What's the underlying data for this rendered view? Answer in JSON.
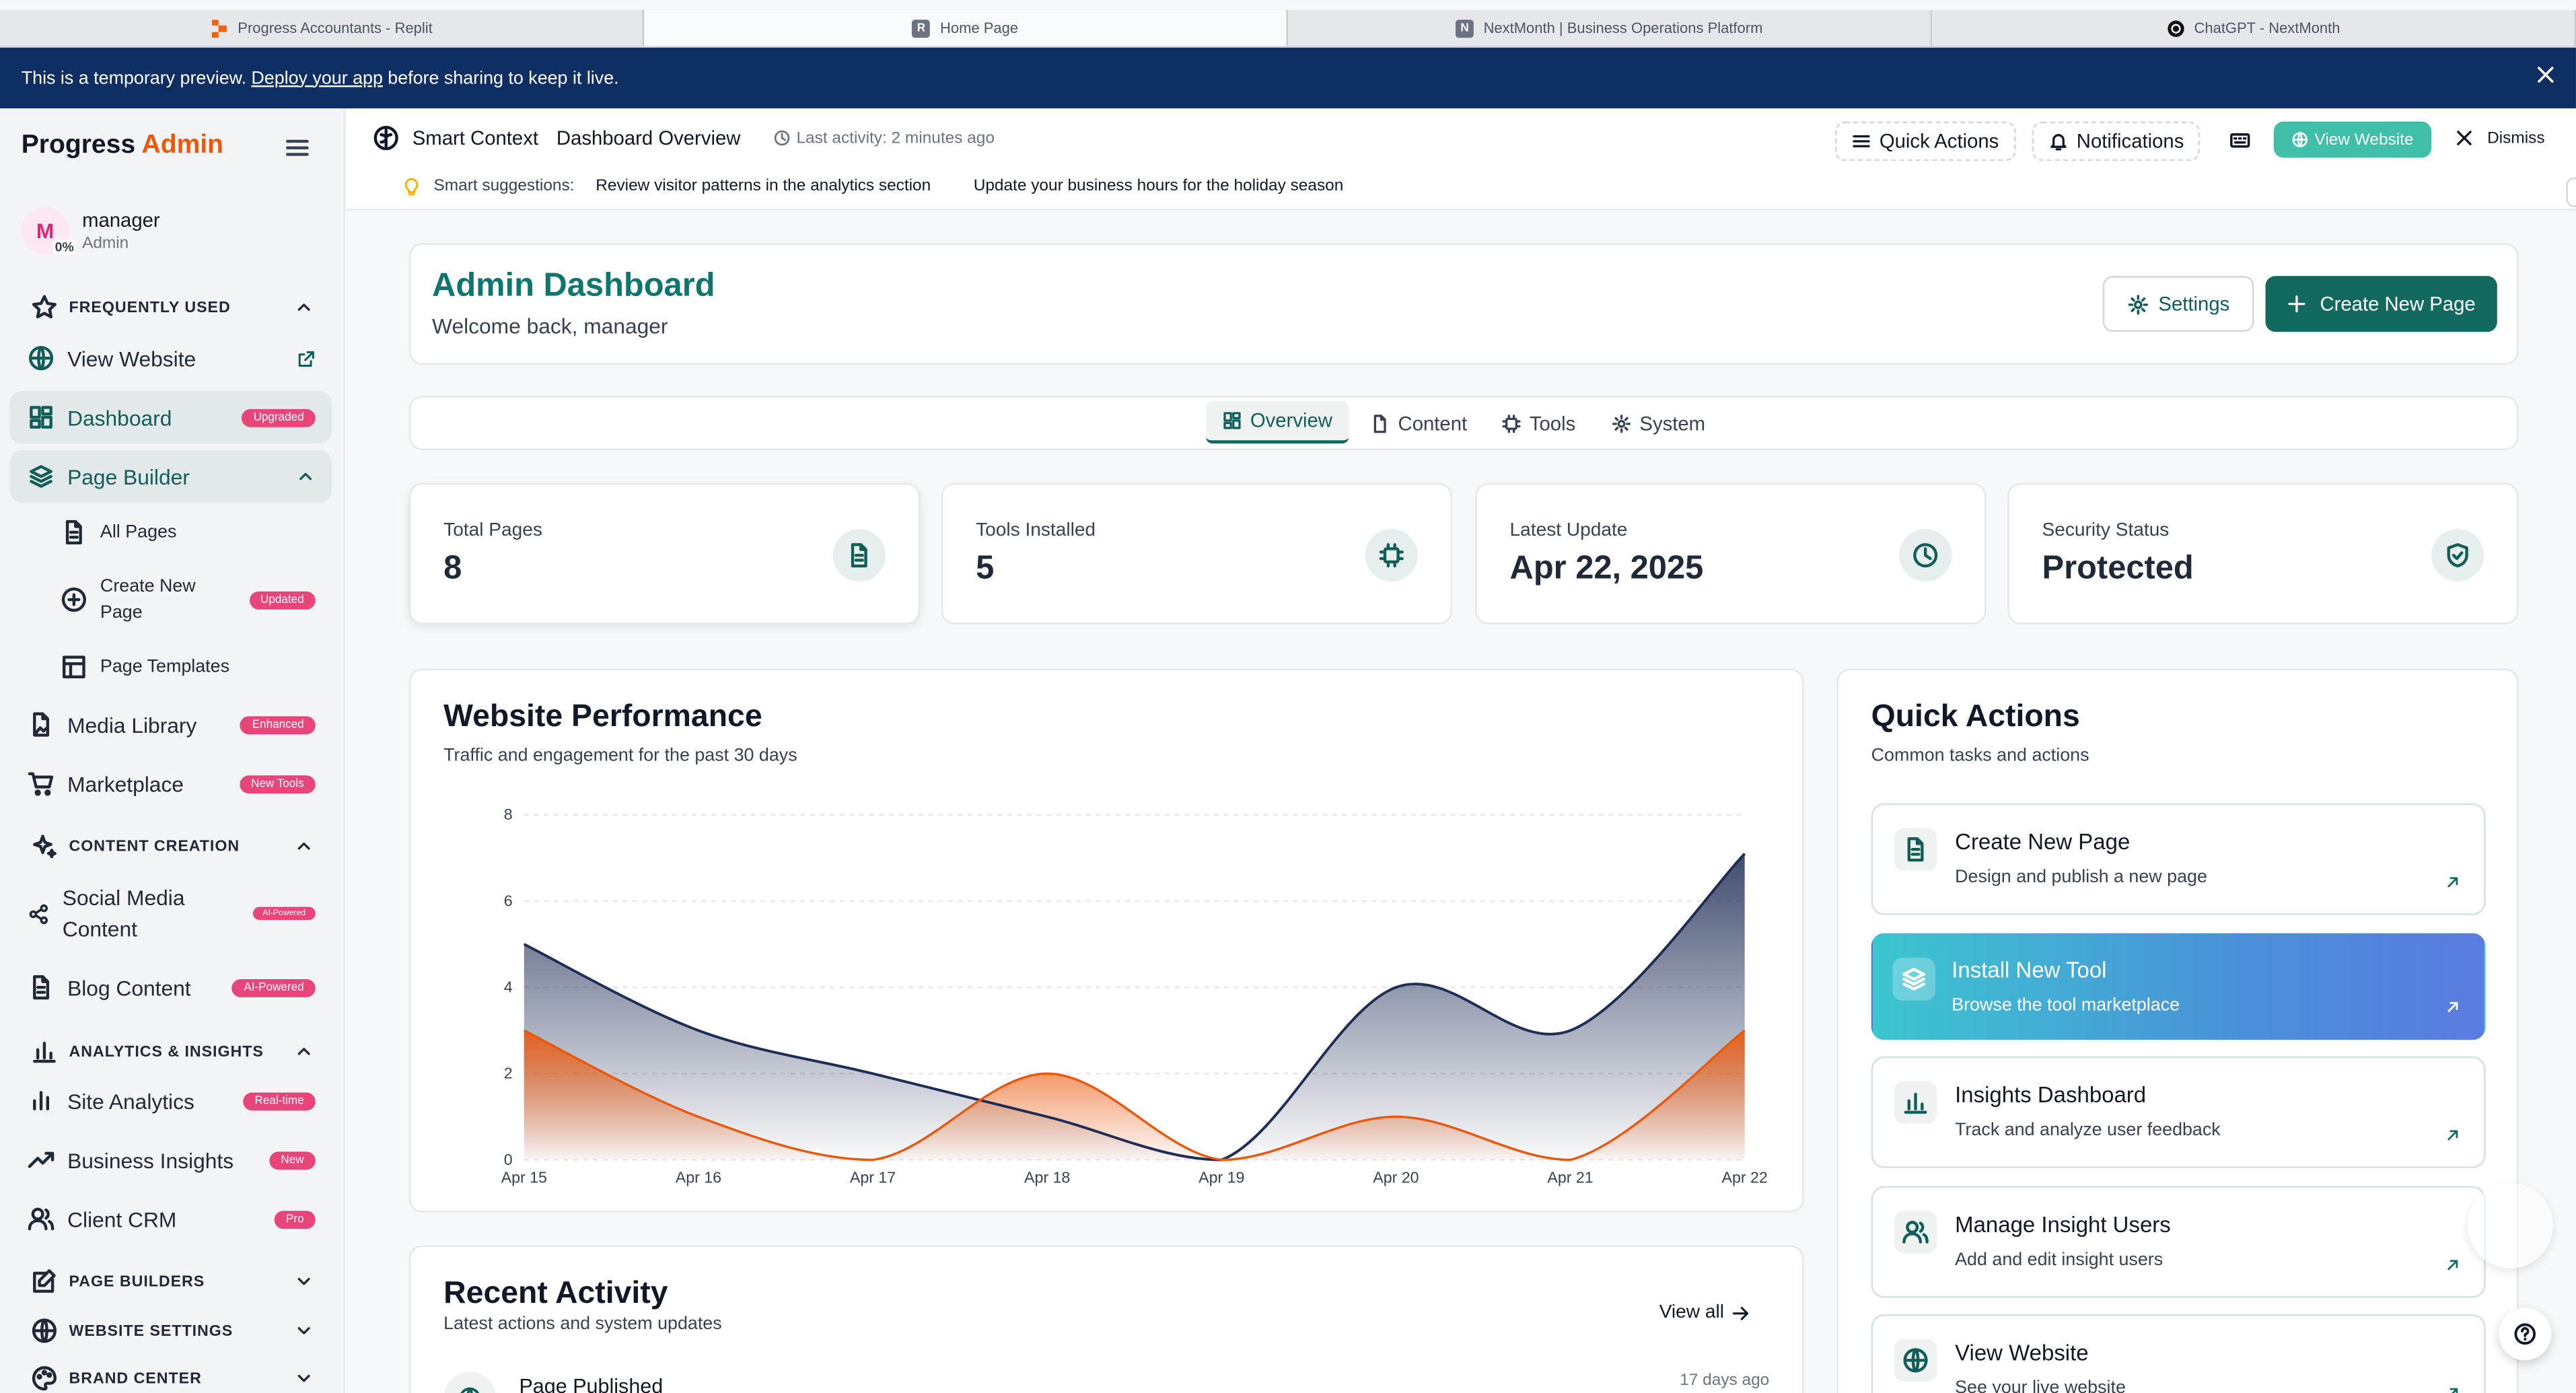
{
  "browser_tabs": [
    {
      "label": "Progress Accountants - Replit",
      "favicon": "replit-icon"
    },
    {
      "label": "Home Page",
      "favicon": "R"
    },
    {
      "label": "NextMonth | Business Operations Platform",
      "favicon": "N"
    },
    {
      "label": "ChatGPT - NextMonth",
      "favicon": "chatgpt-icon"
    }
  ],
  "banner": {
    "text_before": "This is a temporary preview.",
    "link": "Deploy your app",
    "text_after": "before sharing to keep it live."
  },
  "sidebar": {
    "brand_main": "Progress",
    "brand_accent": "Admin",
    "user": {
      "initial": "M",
      "progress": "0%",
      "name": "manager",
      "role": "Admin"
    },
    "sections": {
      "frequently_used": "FREQUENTLY USED",
      "content_creation": "CONTENT CREATION",
      "analytics": "ANALYTICS & INSIGHTS",
      "page_builders": "PAGE BUILDERS",
      "website_settings": "WEBSITE SETTINGS",
      "brand_center": "BRAND CENTER"
    },
    "items": {
      "view_website": {
        "label": "View Website"
      },
      "dashboard": {
        "label": "Dashboard",
        "badge": "Upgraded"
      },
      "page_builder": {
        "label": "Page Builder"
      },
      "all_pages": {
        "label": "All Pages"
      },
      "create_new_page": {
        "label": "Create New Page",
        "badge": "Updated"
      },
      "page_templates": {
        "label": "Page Templates"
      },
      "media_library": {
        "label": "Media Library",
        "badge": "Enhanced"
      },
      "marketplace": {
        "label": "Marketplace",
        "badge": "New Tools"
      },
      "social_media": {
        "label": "Social Media Content",
        "badge": "AI-Powered"
      },
      "blog_content": {
        "label": "Blog Content",
        "badge": "AI-Powered"
      },
      "site_analytics": {
        "label": "Site Analytics",
        "badge": "Real-time"
      },
      "business_insights": {
        "label": "Business Insights",
        "badge": "New"
      },
      "client_crm": {
        "label": "Client CRM",
        "badge": "Pro"
      }
    }
  },
  "context_bar": {
    "title": "Smart Context",
    "subtitle": "Dashboard Overview",
    "last_activity": "Last activity: 2 minutes ago",
    "suggestions_label": "Smart suggestions:",
    "suggestions": [
      "Review visitor patterns in the analytics section",
      "Update your business hours for the holiday season"
    ],
    "quick_actions": "Quick Actions",
    "notifications": "Notifications",
    "view_website": "View Website",
    "dismiss": "Dismiss"
  },
  "header": {
    "title": "Admin Dashboard",
    "welcome": "Welcome back, manager",
    "settings_button": "Settings",
    "create_button": "Create New Page"
  },
  "tabs": [
    "Overview",
    "Content",
    "Tools",
    "System"
  ],
  "stats": [
    {
      "label": "Total Pages",
      "value": "8",
      "icon": "document-icon"
    },
    {
      "label": "Tools Installed",
      "value": "5",
      "icon": "chip-icon"
    },
    {
      "label": "Latest Update",
      "value": "Apr 22, 2025",
      "icon": "clock-icon"
    },
    {
      "label": "Security Status",
      "value": "Protected",
      "icon": "shield-icon"
    }
  ],
  "performance": {
    "title": "Website Performance",
    "subtitle": "Traffic and engagement for the past 30 days"
  },
  "chart_data": {
    "type": "area",
    "categories": [
      "Apr 15",
      "Apr 16",
      "Apr 17",
      "Apr 18",
      "Apr 19",
      "Apr 20",
      "Apr 21",
      "Apr 22"
    ],
    "series": [
      {
        "values": [
          5,
          3,
          2,
          1,
          0,
          4,
          3,
          7.1
        ],
        "color": "#1e2d55"
      },
      {
        "values": [
          3,
          1,
          0,
          2,
          0,
          1,
          0,
          3
        ],
        "color": "#ea580c"
      }
    ],
    "ylim": [
      0,
      8
    ],
    "yticks": [
      "0",
      "2",
      "4",
      "6",
      "8"
    ],
    "grid": true
  },
  "quick_actions": {
    "title": "Quick Actions",
    "subtitle": "Common tasks and actions",
    "items": [
      {
        "title": "Create New Page",
        "desc": "Design and publish a new page"
      },
      {
        "title": "Install New Tool",
        "desc": "Browse the tool marketplace"
      },
      {
        "title": "Insights Dashboard",
        "desc": "Track and analyze user feedback"
      },
      {
        "title": "Manage Insight Users",
        "desc": "Add and edit insight users"
      },
      {
        "title": "View Website",
        "desc": "See your live website"
      }
    ]
  },
  "activity": {
    "title": "Recent Activity",
    "subtitle": "Latest actions and system updates",
    "view_all": "View all",
    "first_item": "Page Published",
    "first_time": "17 days ago"
  }
}
